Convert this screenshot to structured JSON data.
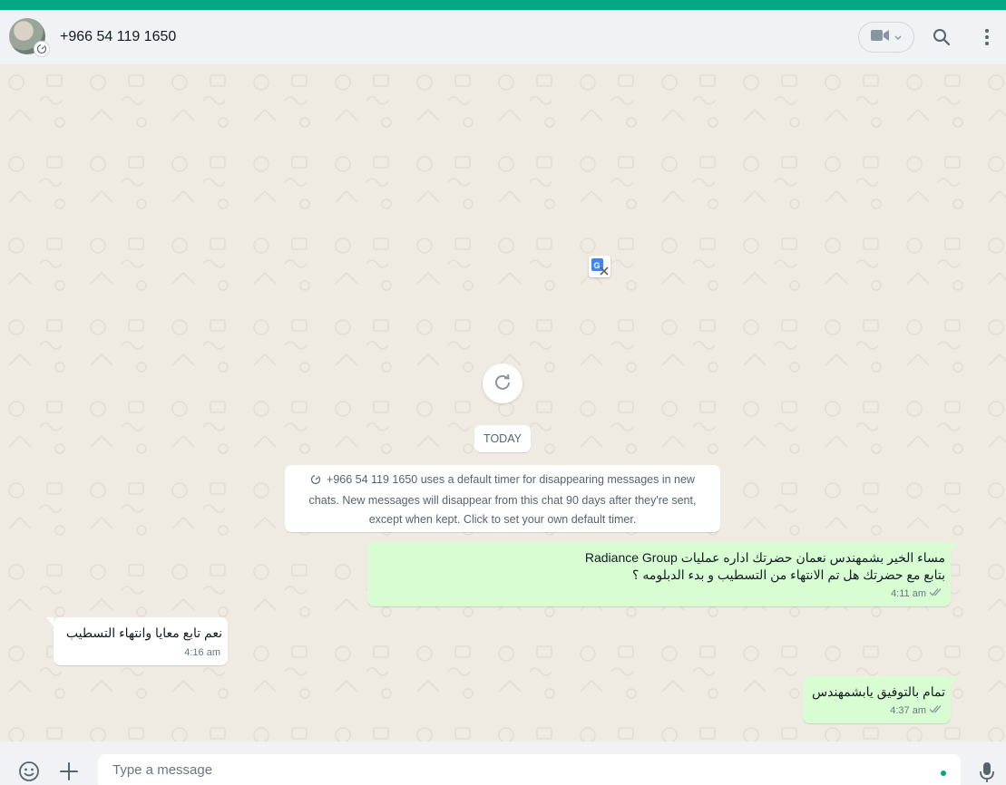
{
  "header": {
    "contact_name": "+966 54 119 1650"
  },
  "chat": {
    "date_divider": "TODAY",
    "system_message": "+966 54 119 1650 uses a default timer for disappearing messages in new chats. New messages will disappear from this chat 90 days after they're sent, except when kept. Click to set your own default timer.",
    "messages": [
      {
        "direction": "outgoing",
        "line1": "مساء الخير بشمهندس نعمان  حضرتك اداره عمليات Radiance Group",
        "line2": "بتابع مع حضرتك هل تم الانتهاء من التسطيب و بدء الدبلومه ؟",
        "time": "4:11 am"
      },
      {
        "direction": "incoming",
        "line1": "نعم تابع معايا وانتهاء التسطيب",
        "time": "4:16 am"
      },
      {
        "direction": "outgoing",
        "line1": "تمام بالتوفيق يابشمهندس",
        "time": "4:37 am"
      }
    ]
  },
  "composer": {
    "placeholder": "Type a message"
  },
  "colors": {
    "accent": "#00a884",
    "outgoing_bubble": "#d9fdd3",
    "incoming_bubble": "#ffffff",
    "chat_background": "#efeae2",
    "read_ticks": "#8696a0"
  },
  "icons": [
    "timer-icon",
    "video-camera-icon",
    "chevron-down-icon",
    "search-icon",
    "menu-icon",
    "translate-icon",
    "refresh-icon",
    "double-check-icon",
    "emoji-icon",
    "plus-icon",
    "microphone-icon"
  ]
}
